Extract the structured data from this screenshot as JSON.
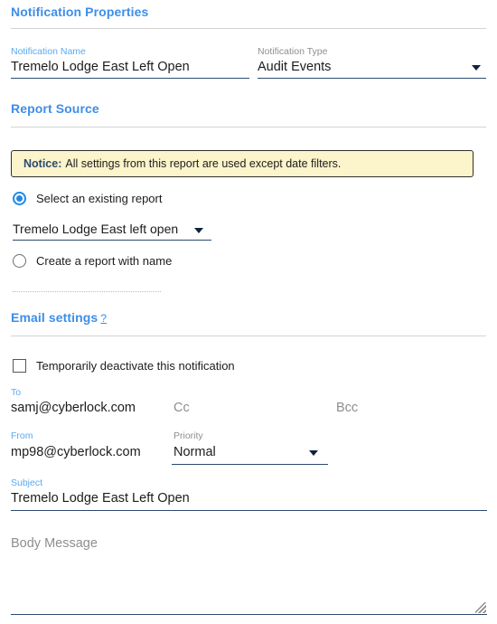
{
  "sections": {
    "notification_properties": "Notification Properties",
    "report_source": "Report Source",
    "email_settings": "Email settings",
    "email_settings_help": "?"
  },
  "notification": {
    "name_label": "Notification Name",
    "name_value": "Tremelo Lodge East Left Open",
    "type_label": "Notification Type",
    "type_value": "Audit Events"
  },
  "report_source": {
    "notice_prefix": "Notice:",
    "notice_text": "All settings from this report are used except date filters.",
    "option_existing": "Select an existing report",
    "existing_report_value": "Tremelo Lodge East left open",
    "option_create": "Create a report with name",
    "create_report_value": ""
  },
  "email": {
    "deactivate_label": "Temporarily deactivate this notification",
    "to_label": "To",
    "to_value": "samj@cyberlock.com",
    "cc_placeholder": "Cc",
    "bcc_placeholder": "Bcc",
    "from_label": "From",
    "from_value": "mp98@cyberlock.com",
    "priority_placeholder": "Priority",
    "priority_value": "Normal",
    "subject_label": "Subject",
    "subject_value": "Tremelo Lodge East Left Open",
    "body_placeholder": "Body Message"
  }
}
